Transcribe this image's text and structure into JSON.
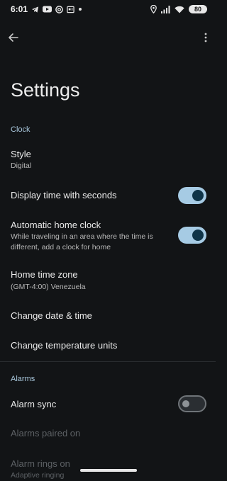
{
  "status_bar": {
    "time": "6:01",
    "battery": "80",
    "left_icons": [
      "telegram-icon",
      "youtube-icon",
      "chrome-icon",
      "news-icon",
      "dot-icon"
    ],
    "right_icons": [
      "location-icon",
      "signal-icon",
      "wifi-icon",
      "battery-icon"
    ]
  },
  "app_bar": {
    "back_icon": "arrow-back-icon",
    "menu_icon": "more-vert-icon"
  },
  "title": "Settings",
  "sections": {
    "clock": {
      "header": "Clock",
      "style": {
        "title": "Style",
        "value": "Digital"
      },
      "seconds": {
        "title": "Display time with seconds",
        "enabled": true
      },
      "home_clock": {
        "title": "Automatic home clock",
        "summary_line1": "While traveling in an area where the time is",
        "summary_line2": "different, add a clock for home",
        "enabled": true
      },
      "home_time_zone": {
        "title": "Home time zone",
        "value": "(GMT-4:00) Venezuela"
      },
      "change_date_time": {
        "title": "Change date & time"
      },
      "temperature_units": {
        "title": "Change temperature units"
      }
    },
    "alarms": {
      "header": "Alarms",
      "alarm_sync": {
        "title": "Alarm sync",
        "enabled": false
      },
      "alarms_paired_on": {
        "title": "Alarms paired on"
      },
      "alarm_rings_on": {
        "title": "Alarm rings on",
        "value": "Adaptive ringing"
      }
    }
  },
  "colors": {
    "background": "#121416",
    "accent": "#a6cbe4",
    "section_header": "#a9c7dc",
    "disabled_text": "#5d6165"
  }
}
